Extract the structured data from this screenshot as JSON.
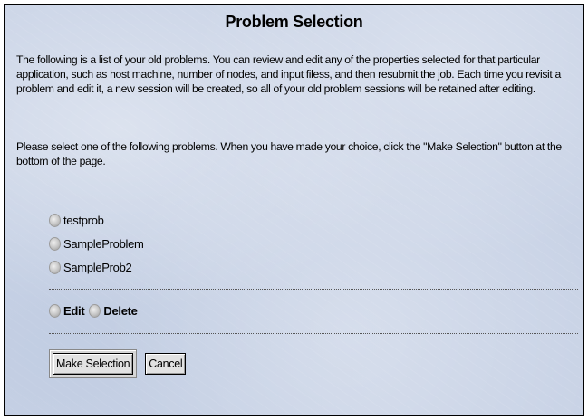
{
  "page": {
    "title": "Problem Selection",
    "intro_text": "The following is a list of your old problems. You can review and edit any of the properties selected for that particular application, such as host machine, number of nodes, and input filess, and then resubmit the job. Each time you revisit a problem and edit it, a new session will be created, so all of your old problem sessions will be retained after editing.",
    "instruction_text": "Please select one of the following problems. When you have made your choice, click the \"Make Selection\" button at the bottom of the page."
  },
  "problems": [
    {
      "label": "testprob",
      "selected": false
    },
    {
      "label": "SampleProblem",
      "selected": false
    },
    {
      "label": "SampleProb2",
      "selected": false
    }
  ],
  "actions": {
    "edit_label": "Edit",
    "delete_label": "Delete"
  },
  "buttons": {
    "make_selection_label": "Make Selection",
    "cancel_label": "Cancel"
  },
  "colors": {
    "background": "#c9d3e6",
    "border": "#000000",
    "text": "#000000"
  }
}
